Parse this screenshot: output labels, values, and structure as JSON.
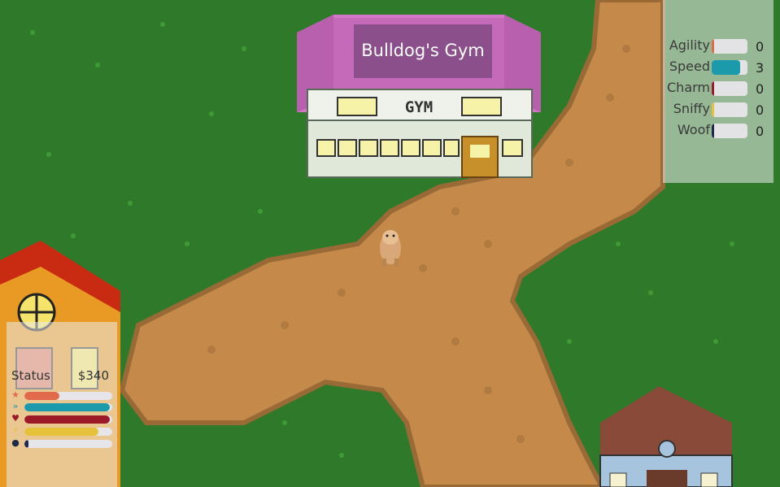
{
  "gym": {
    "sign_text": "Bulldog's Gym",
    "building_label": "GYM"
  },
  "stats_panel": {
    "items": [
      {
        "label": "Agility",
        "value": "0",
        "fill": 0.06,
        "color": "#e06a4a"
      },
      {
        "label": "Speed",
        "value": "3",
        "fill": 0.8,
        "color": "#1a9aab"
      },
      {
        "label": "Charm",
        "value": "0",
        "fill": 0.06,
        "color": "#9c1a28"
      },
      {
        "label": "Sniffy",
        "value": "0",
        "fill": 0.06,
        "color": "#e6c23a"
      },
      {
        "label": "Woof",
        "value": "0",
        "fill": 0.06,
        "color": "#1e2a4a"
      }
    ]
  },
  "status_panel": {
    "title": "Status",
    "money": "$340",
    "bars": [
      {
        "icon": "star-icon",
        "glyph": "★",
        "fill": 0.4,
        "color": "#e06a4a"
      },
      {
        "icon": "speed-icon",
        "glyph": "»",
        "fill": 0.97,
        "color": "#1a9aab"
      },
      {
        "icon": "heart-icon",
        "glyph": "♥",
        "fill": 0.97,
        "color": "#9c1a28"
      },
      {
        "icon": "lightning-icon",
        "glyph": "⚡",
        "fill": 0.84,
        "color": "#e6c23a"
      },
      {
        "icon": "speech-icon",
        "glyph": "●",
        "fill": 0.05,
        "color": "#1e2a4a"
      }
    ]
  }
}
